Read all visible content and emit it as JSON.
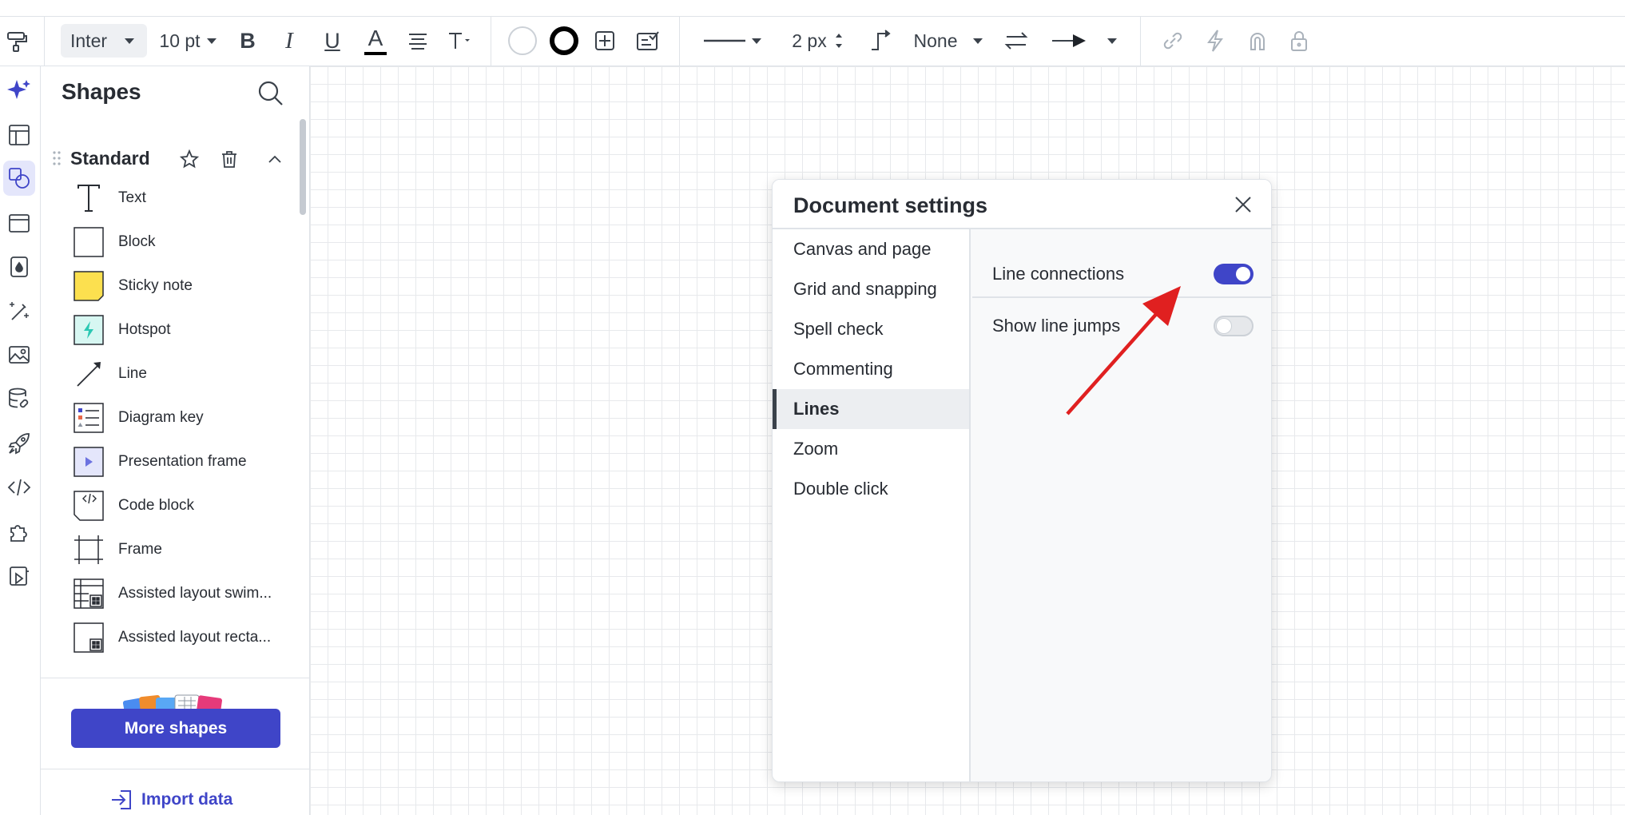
{
  "toolbar": {
    "font_family": "Inter",
    "font_size": "10 pt",
    "bold_label": "B",
    "italic_label": "I",
    "underline_label": "U",
    "text_color_label": "A",
    "line_width": "2 px",
    "arrow_start": "None",
    "text_color_swatch": "#000000"
  },
  "shapes_panel": {
    "title": "Shapes",
    "group_title": "Standard",
    "items": [
      {
        "label": "Text",
        "icon": "text-icon"
      },
      {
        "label": "Block",
        "icon": "block-icon"
      },
      {
        "label": "Sticky note",
        "icon": "sticky-note-icon"
      },
      {
        "label": "Hotspot",
        "icon": "hotspot-icon"
      },
      {
        "label": "Line",
        "icon": "line-icon"
      },
      {
        "label": "Diagram key",
        "icon": "diagram-key-icon"
      },
      {
        "label": "Presentation frame",
        "icon": "presentation-frame-icon"
      },
      {
        "label": "Code block",
        "icon": "code-block-icon"
      },
      {
        "label": "Frame",
        "icon": "frame-icon"
      },
      {
        "label": "Assisted layout swim...",
        "icon": "assisted-layout-swimlane-icon"
      },
      {
        "label": "Assisted layout recta...",
        "icon": "assisted-layout-rectangle-icon"
      }
    ],
    "more_shapes_label": "More shapes",
    "import_data_label": "Import data"
  },
  "dialog": {
    "title": "Document settings",
    "nav": [
      {
        "label": "Canvas and page",
        "active": false
      },
      {
        "label": "Grid and snapping",
        "active": false
      },
      {
        "label": "Spell check",
        "active": false
      },
      {
        "label": "Commenting",
        "active": false
      },
      {
        "label": "Lines",
        "active": true
      },
      {
        "label": "Zoom",
        "active": false
      },
      {
        "label": "Double click",
        "active": false
      }
    ],
    "settings": [
      {
        "label": "Line connections",
        "enabled": true
      },
      {
        "label": "Show line jumps",
        "enabled": false
      }
    ]
  },
  "colors": {
    "accent": "#3f45c8",
    "sticky_note": "#fce04f",
    "hotspot": "#2bc8b3",
    "annotation_arrow": "#e02020"
  }
}
